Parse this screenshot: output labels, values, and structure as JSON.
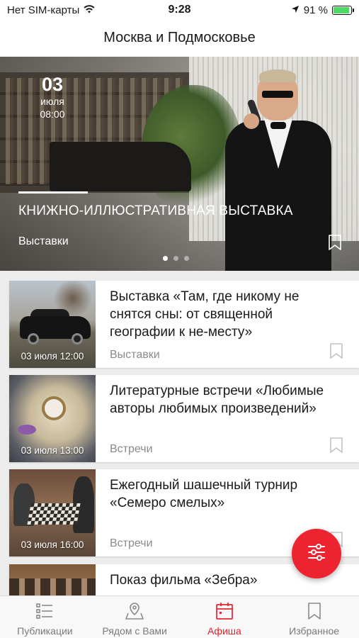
{
  "status_bar": {
    "carrier": "Нет SIM-карты",
    "time": "9:28",
    "battery_percent": "91 %",
    "battery_level": 0.91
  },
  "header": {
    "title": "Москва и Подмосковье"
  },
  "featured": {
    "day": "03",
    "month": "июля",
    "time": "08:00",
    "title": "КНИЖНО-ИЛЛЮСТРАТИВНАЯ ВЫСТАВКА",
    "category": "Выставки",
    "slides_total": 3,
    "active_slide": 1
  },
  "events": [
    {
      "title": "Выставка «Там, где никому не снятся сны: от священной географии к не-месту»",
      "date": "03 июля 12:00",
      "category": "Выставки"
    },
    {
      "title": "Литературные встречи «Любимые авторы любимых произведений»",
      "date": "03 июля 13:00",
      "category": "Встречи"
    },
    {
      "title": "Ежегодный шашечный турнир «Семеро смелых»",
      "date": "03 июля 16:00",
      "category": "Встречи"
    },
    {
      "title": "Показ фильма «Зебра»",
      "date": "",
      "category": ""
    }
  ],
  "tabs": [
    {
      "label": "Публикации",
      "icon": "list-icon",
      "active": false
    },
    {
      "label": "Рядом с Вами",
      "icon": "map-pin-icon",
      "active": false
    },
    {
      "label": "Афиша",
      "icon": "calendar-icon",
      "active": true
    },
    {
      "label": "Избранное",
      "icon": "bookmark-icon",
      "active": false
    }
  ],
  "colors": {
    "accent": "#e8232f",
    "fab": "#ee2330",
    "battery": "#4cd964"
  }
}
